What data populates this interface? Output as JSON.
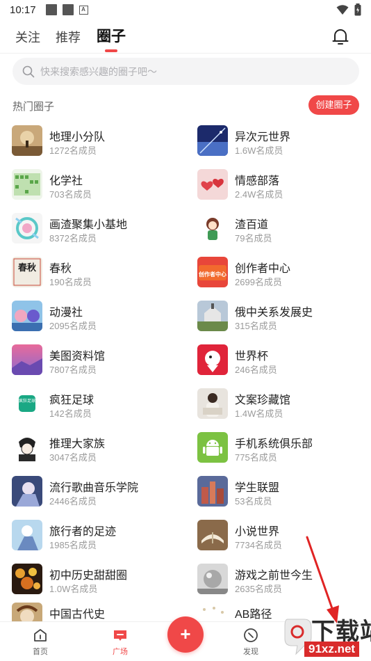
{
  "status_bar": {
    "time": "10:17"
  },
  "top_tabs": [
    {
      "label": "关注"
    },
    {
      "label": "推荐"
    },
    {
      "label": "圈子"
    }
  ],
  "search": {
    "placeholder": "快来搜索感兴趣的圈子吧～"
  },
  "section": {
    "title": "热门圈子",
    "create_label": "创建圈子"
  },
  "circles": [
    {
      "name": "地理小分队",
      "members": "1272名成员"
    },
    {
      "name": "异次元世界",
      "members": "1.6W名成员"
    },
    {
      "name": "化学社",
      "members": "703名成员"
    },
    {
      "name": "情感部落",
      "members": "2.4W名成员"
    },
    {
      "name": "画渣聚集小基地",
      "members": "8372名成员"
    },
    {
      "name": "渣百道",
      "members": "79名成员"
    },
    {
      "name": "春秋",
      "members": "190名成员"
    },
    {
      "name": "创作者中心",
      "members": "2699名成员"
    },
    {
      "name": "动漫社",
      "members": "2095名成员"
    },
    {
      "name": "俄中关系发展史",
      "members": "315名成员"
    },
    {
      "name": "美图资料馆",
      "members": "7807名成员"
    },
    {
      "name": "世界杯",
      "members": "246名成员"
    },
    {
      "name": "疯狂足球",
      "members": "142名成员"
    },
    {
      "name": "文案珍藏馆",
      "members": "1.4W名成员"
    },
    {
      "name": "推理大家族",
      "members": "3047名成员"
    },
    {
      "name": "手机系统俱乐部",
      "members": "775名成员"
    },
    {
      "name": "流行歌曲音乐学院",
      "members": "2446名成员"
    },
    {
      "name": "学生联盟",
      "members": "53名成员"
    },
    {
      "name": "旅行者的足迹",
      "members": "1985名成员"
    },
    {
      "name": "小说世界",
      "members": "7734名成员"
    },
    {
      "name": "初中历史甜甜圈",
      "members": "1.0W名成员"
    },
    {
      "name": "游戏之前世今生",
      "members": "2635名成员"
    },
    {
      "name": "中国古代史",
      "members": ""
    },
    {
      "name": "AB路径",
      "members": ""
    }
  ],
  "thumb_text": {
    "chunqiu": "春秋",
    "creator": "创作者中心",
    "football": "疯狂足球"
  },
  "bottom_nav": {
    "home": "首页",
    "square": "广场",
    "discover": "发现",
    "fab": "+"
  },
  "watermark": {
    "title": "下载站",
    "url": "91xz.net"
  },
  "colors": {
    "accent": "#f04848",
    "watermark_red": "#d92b2b"
  }
}
